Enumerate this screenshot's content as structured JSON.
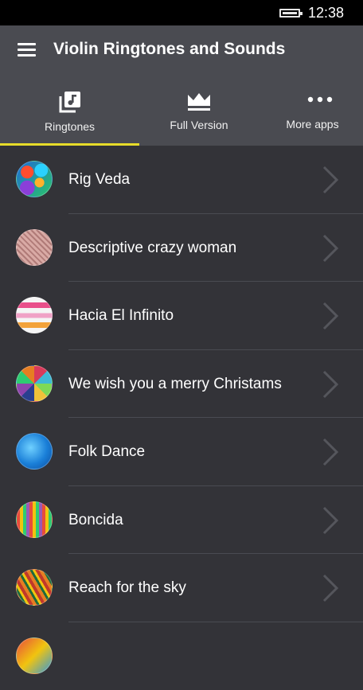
{
  "status_bar": {
    "time": "12:38"
  },
  "header": {
    "title": "Violin Ringtones and Sounds"
  },
  "tabs": [
    {
      "label": "Ringtones",
      "icon": "music-library-icon",
      "selected": true
    },
    {
      "label": "Full Version",
      "icon": "crown-icon",
      "selected": false
    },
    {
      "label": "More apps",
      "icon": "more-dots-icon",
      "selected": false
    }
  ],
  "colors": {
    "accent": "#e8dc2a",
    "header_bg": "#4a4b51",
    "list_bg": "#333338"
  },
  "ringtones": [
    {
      "title": "Rig Veda"
    },
    {
      "title": "Descriptive crazy woman"
    },
    {
      "title": "Hacia El Infinito"
    },
    {
      "title": "We wish you a merry Christams"
    },
    {
      "title": "Folk Dance"
    },
    {
      "title": "Boncida"
    },
    {
      "title": "Reach for the sky"
    }
  ]
}
